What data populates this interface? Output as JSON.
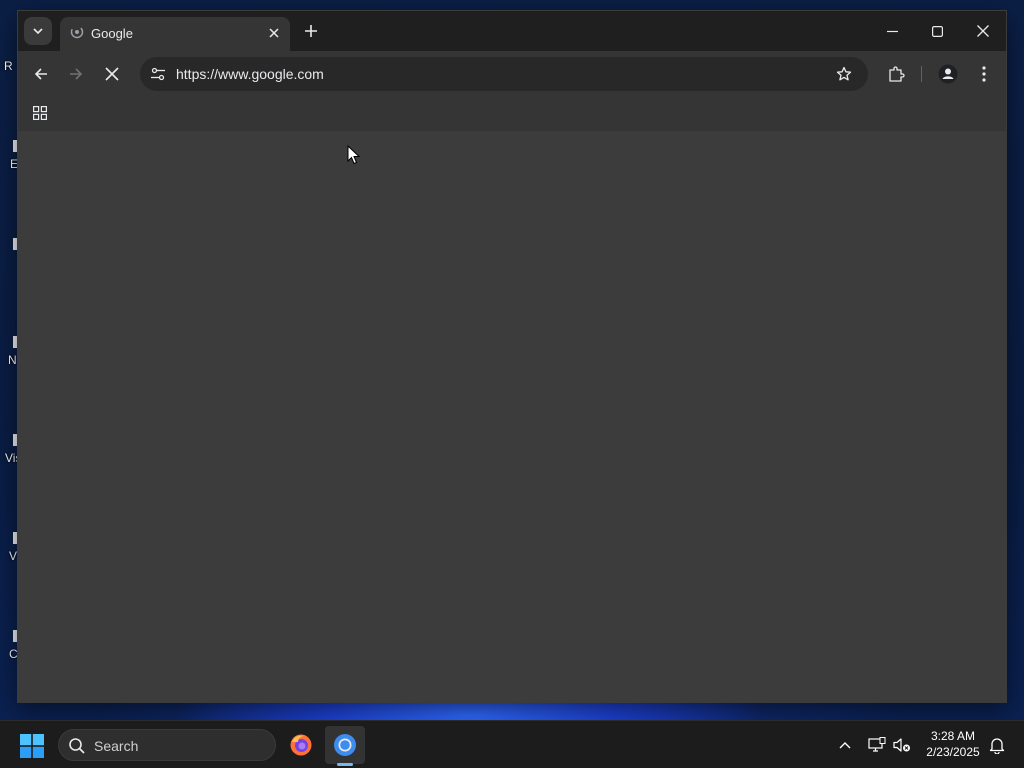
{
  "desktop": {
    "icon_labels": [
      "R",
      "E",
      "",
      "N",
      "Vis",
      "V",
      "C"
    ]
  },
  "browser": {
    "tab": {
      "title": "Google"
    },
    "address_bar": {
      "url": "https://www.google.com"
    }
  },
  "taskbar": {
    "search_label": "Search",
    "apps": [
      "firefox-icon",
      "chrome-icon"
    ],
    "clock": {
      "time": "3:28 AM",
      "date": "2/23/2025"
    }
  },
  "colors": {
    "window_bg": "#1f1f1f",
    "toolbar_bg": "#353535",
    "content_bg": "#3c3c3c",
    "omnibox_bg": "#282828",
    "taskbar_bg": "#1c1c1c",
    "accent": "#76b9ed"
  }
}
